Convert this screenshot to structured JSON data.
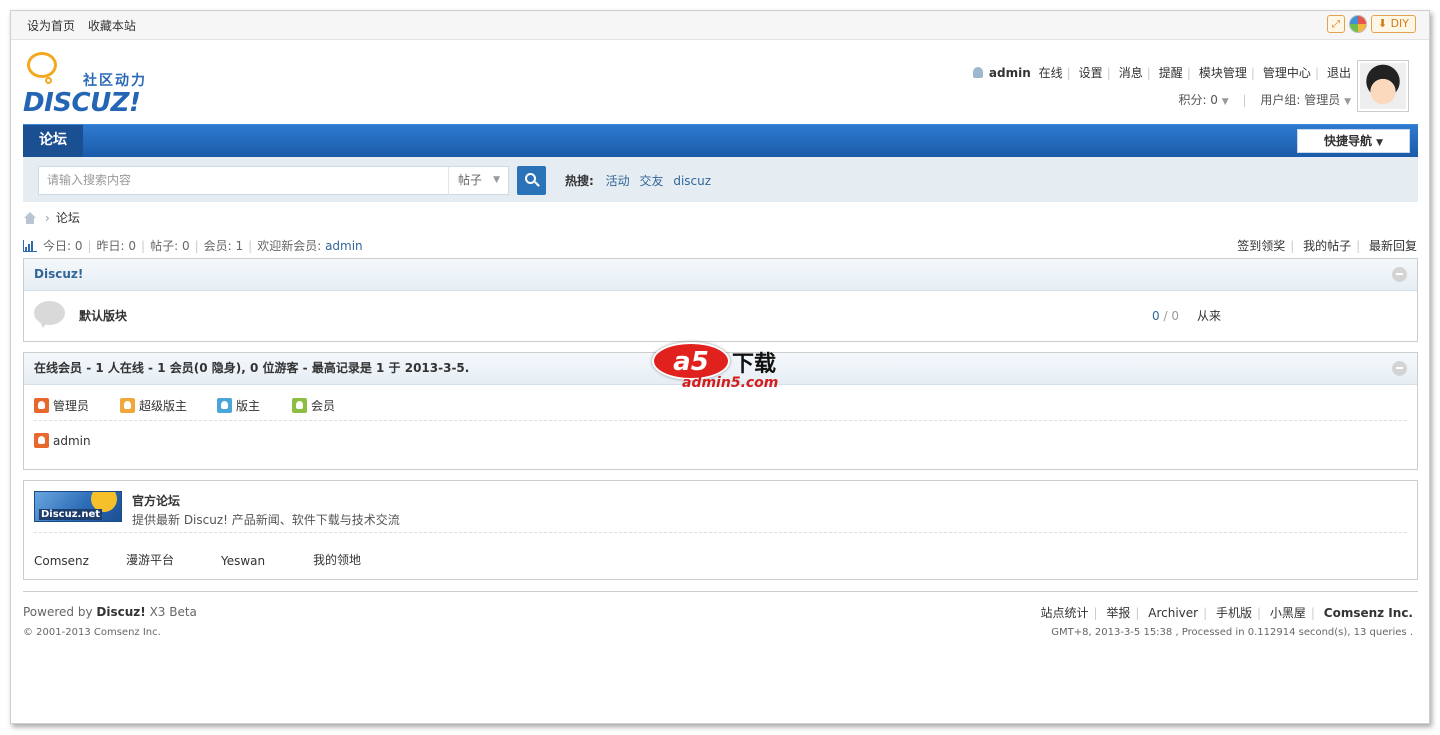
{
  "topbar": {
    "links": [
      "设为首页",
      "收藏本站"
    ],
    "diy_label": "DIY"
  },
  "header": {
    "logo_cn": "社区动力",
    "logo_brand": "DISCUZ!",
    "username": "admin",
    "online_text": "在线",
    "user_links": [
      "设置",
      "消息",
      "提醒",
      "模块管理",
      "管理中心",
      "退出"
    ],
    "points_label": "积分: 0",
    "group_label": "用户组: 管理员"
  },
  "nav": {
    "active_item": "论坛",
    "quick_nav": "快捷导航"
  },
  "search": {
    "placeholder": "请输入搜索内容",
    "type": "帖子",
    "hot_label": "热搜:",
    "hot_terms": [
      "活动",
      "交友",
      "discuz"
    ]
  },
  "breadcrumb": {
    "current": "论坛"
  },
  "stats": {
    "today": "今日: 0",
    "yesterday": "昨日: 0",
    "posts": "帖子: 0",
    "members": "会员: 1",
    "welcome": "欢迎新会员:",
    "newest_member": "admin",
    "right_links": [
      "签到领奖",
      "我的帖子",
      "最新回复"
    ]
  },
  "forum_group": {
    "title": "Discuz!",
    "forums": [
      {
        "name": "默认版块",
        "threads": "0",
        "posts": "0",
        "last_post": "从来"
      }
    ]
  },
  "online": {
    "title": "在线会员",
    "summary": " - 1 人在线  - 1 会员(0 隐身), 0 位游客  - 最高记录是  1 于  2013-3-5.",
    "legend": [
      {
        "label": "管理员",
        "color": "#e8672d"
      },
      {
        "label": "超级版主",
        "color": "#f2a73b"
      },
      {
        "label": "版主",
        "color": "#4aa6d8"
      },
      {
        "label": "会员",
        "color": "#8cbf3f"
      }
    ],
    "members": [
      {
        "name": "admin",
        "color": "#e8672d"
      }
    ]
  },
  "links_box": {
    "logo_text": "Discuz.net",
    "title": "官方论坛",
    "description": "提供最新 Discuz! 产品新闻、软件下载与技术交流",
    "partners": [
      "Comsenz",
      "漫游平台",
      "Yeswan",
      "我的领地"
    ]
  },
  "footer": {
    "powered_prefix": "Powered by",
    "powered_brand": "Discuz!",
    "powered_version": "X3 Beta",
    "copyright": "© 2001-2013 Comsenz Inc.",
    "links": [
      "站点统计",
      "举报",
      "Archiver",
      "手机版",
      "小黑屋"
    ],
    "company": "Comsenz Inc.",
    "meta": "GMT+8, 2013-3-5 15:38 , Processed in 0.112914 second(s), 13 queries ."
  },
  "watermark": {
    "logo": "a5",
    "cn": "下载",
    "url": "admin5.com"
  },
  "colors": {
    "nav_blue": "#2465b4",
    "link_blue": "#336699",
    "search_btn": "#2a73b8"
  }
}
